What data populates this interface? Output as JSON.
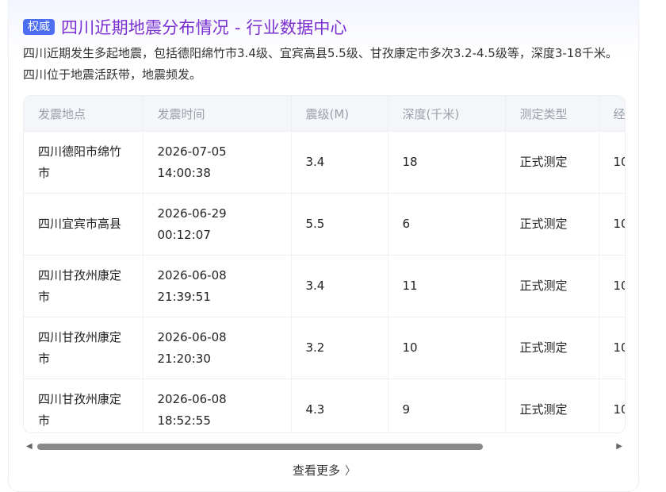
{
  "header": {
    "badge": "权威",
    "title": "四川近期地震分布情况 - 行业数据中心"
  },
  "description": "四川近期发生多起地震，包括德阳绵竹市3.4级、宜宾高县5.5级、甘孜康定市多次3.2-4.5级等，深度3-18千米。四川位于地震活跃带，地震频发。",
  "table": {
    "columns": [
      "发震地点",
      "发震时间",
      "震级(M)",
      "深度(千米)",
      "测定类型",
      "经"
    ],
    "rows": [
      {
        "location": "四川德阳市绵竹市",
        "time": "2026-07-05 14:00:38",
        "magnitude": "3.4",
        "depth": "18",
        "type": "正式测定",
        "lon": "10"
      },
      {
        "location": "四川宜宾市高县",
        "time": "2026-06-29 00:12:07",
        "magnitude": "5.5",
        "depth": "6",
        "type": "正式测定",
        "lon": "10"
      },
      {
        "location": "四川甘孜州康定市",
        "time": "2026-06-08 21:39:51",
        "magnitude": "3.4",
        "depth": "11",
        "type": "正式测定",
        "lon": "10"
      },
      {
        "location": "四川甘孜州康定市",
        "time": "2026-06-08 21:20:30",
        "magnitude": "3.2",
        "depth": "10",
        "type": "正式测定",
        "lon": "10"
      },
      {
        "location": "四川甘孜州康定市",
        "time": "2026-06-08 18:52:55",
        "magnitude": "4.3",
        "depth": "9",
        "type": "正式测定",
        "lon": "10"
      }
    ]
  },
  "footer": {
    "more_label": "查看更多"
  }
}
